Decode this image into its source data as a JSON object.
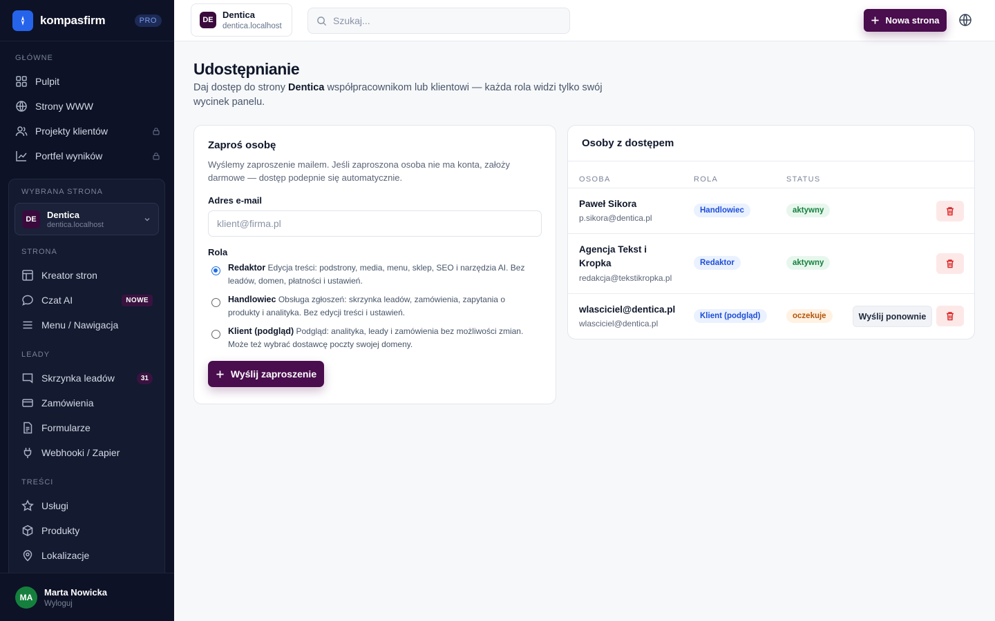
{
  "brand": {
    "name": "kompasfirm",
    "badge": "PRO"
  },
  "sidebar": {
    "section_main": "GŁÓWNE",
    "main_items": [
      {
        "label": "Pulpit",
        "icon": "grid-icon"
      },
      {
        "label": "Strony WWW",
        "icon": "globe-icon"
      },
      {
        "label": "Projekty klientów",
        "icon": "users-icon",
        "locked": true
      },
      {
        "label": "Portfel wyników",
        "icon": "chart-icon",
        "locked": true
      }
    ],
    "selected_site_label": "WYBRANA STRONA",
    "selected_site": {
      "initials": "DE",
      "name": "Dentica",
      "domain": "dentica.localhost"
    },
    "section_site": "STRONA",
    "site_items": [
      {
        "label": "Kreator stron",
        "icon": "layout-icon"
      },
      {
        "label": "Czat AI",
        "icon": "chat-icon",
        "badge": "NOWE"
      },
      {
        "label": "Menu / Nawigacja",
        "icon": "menu-icon"
      }
    ],
    "section_leads": "LEADY",
    "lead_items": [
      {
        "label": "Skrzynka leadów",
        "icon": "inbox-icon",
        "badge": "31"
      },
      {
        "label": "Zamówienia",
        "icon": "card-icon"
      },
      {
        "label": "Formularze",
        "icon": "form-icon"
      },
      {
        "label": "Webhooki / Zapier",
        "icon": "plug-icon"
      }
    ],
    "section_content": "TREŚCI",
    "content_items": [
      {
        "label": "Usługi",
        "icon": "star-icon"
      },
      {
        "label": "Produkty",
        "icon": "box-icon"
      },
      {
        "label": "Lokalizacje",
        "icon": "pin-icon"
      }
    ],
    "user": {
      "initials": "MA",
      "name": "Marta Nowicka",
      "logout": "Wyloguj"
    }
  },
  "topbar": {
    "site": {
      "initials": "DE",
      "name": "Dentica",
      "domain": "dentica.localhost"
    },
    "search_placeholder": "Szukaj...",
    "new_page_label": "Nowa strona"
  },
  "page": {
    "title": "Udostępnianie",
    "lead_before": "Daj dostęp do strony ",
    "lead_site": "Dentica",
    "lead_after": " współpracownikom lub klientowi — każda rola widzi tylko swój wycinek panelu."
  },
  "invite": {
    "title": "Zaproś osobę",
    "description": "Wyślemy zaproszenie mailem. Jeśli zaproszona osoba nie ma konta, założy darmowe — dostęp podepnie się automatycznie.",
    "email_label": "Adres e-mail",
    "email_placeholder": "klient@firma.pl",
    "role_label": "Rola",
    "roles": [
      {
        "name": "Redaktor",
        "desc": "Edycja treści: podstrony, media, menu, sklep, SEO i narzędzia AI. Bez leadów, domen, płatności i ustawień.",
        "selected": true
      },
      {
        "name": "Handlowiec",
        "desc": "Obsługa zgłoszeń: skrzynka leadów, zamówienia, zapytania o produkty i analityka. Bez edycji treści i ustawień.",
        "selected": false
      },
      {
        "name": "Klient (podgląd)",
        "desc": "Podgląd: analityka, leady i zamówienia bez możliwości zmian. Może też wybrać dostawcę poczty swojej domeny.",
        "selected": false
      }
    ],
    "submit_label": "Wyślij zaproszenie"
  },
  "people": {
    "title": "Osoby z dostępem",
    "columns": {
      "person": "OSOBA",
      "role": "ROLA",
      "status": "STATUS"
    },
    "rows": [
      {
        "name": "Paweł Sikora",
        "email": "p.sikora@dentica.pl",
        "role": "Handlowiec",
        "status": "aktywny",
        "status_type": "ok"
      },
      {
        "name_line1": "Agencja Tekst i",
        "name_line2": "Kropka",
        "email": "redakcja@tekstikropka.pl",
        "role": "Redaktor",
        "status": "aktywny",
        "status_type": "ok"
      },
      {
        "name": "wlasciciel@dentica.pl",
        "email": "wlasciciel@dentica.pl",
        "role": "Klient (podgląd)",
        "status": "oczekuje",
        "status_type": "wait",
        "action": "Wyślij ponownie"
      }
    ]
  },
  "colors": {
    "sidebar_bg": "#0d1226",
    "accent": "#4a0d4e",
    "brand_blue": "#2563eb"
  }
}
